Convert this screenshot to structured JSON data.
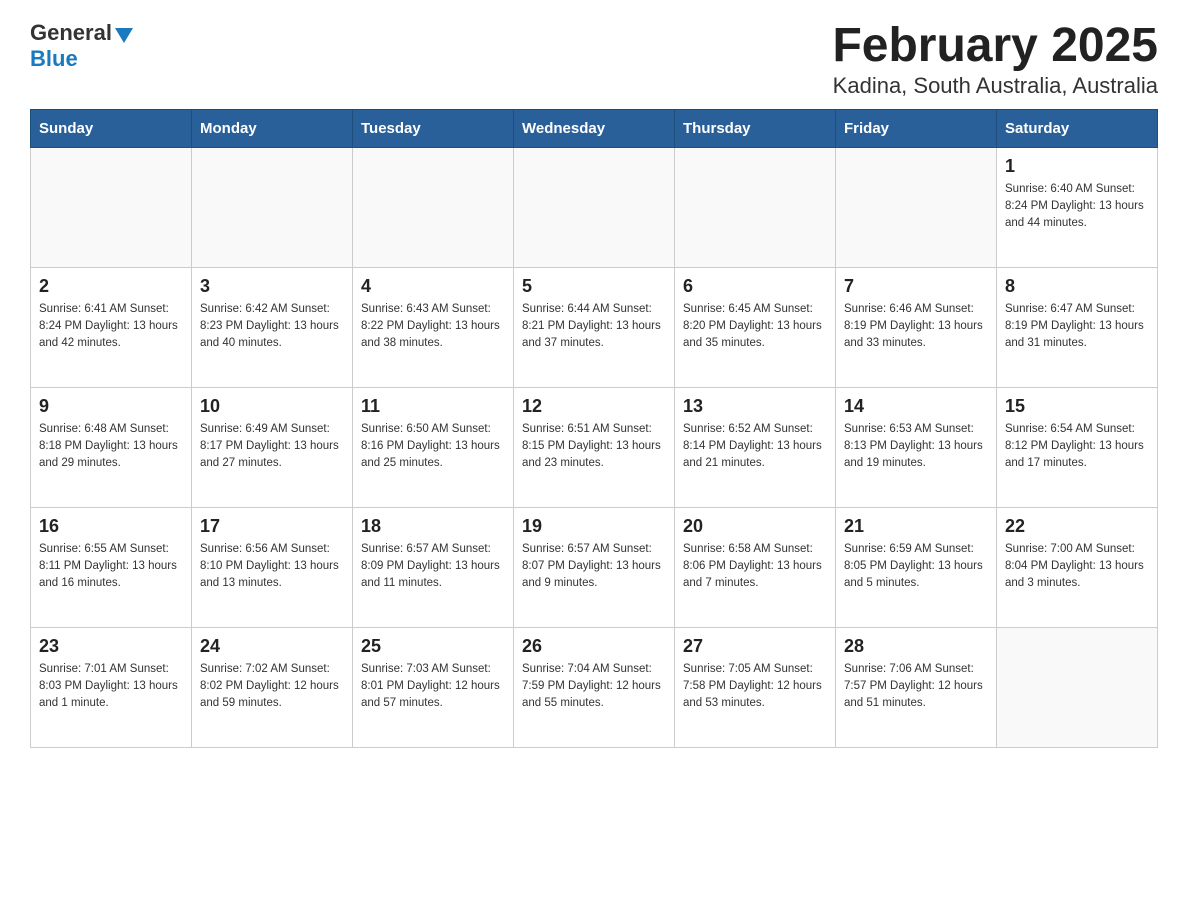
{
  "logo": {
    "general": "General",
    "blue": "Blue"
  },
  "title": "February 2025",
  "subtitle": "Kadina, South Australia, Australia",
  "weekdays": [
    "Sunday",
    "Monday",
    "Tuesday",
    "Wednesday",
    "Thursday",
    "Friday",
    "Saturday"
  ],
  "weeks": [
    [
      {
        "day": "",
        "info": ""
      },
      {
        "day": "",
        "info": ""
      },
      {
        "day": "",
        "info": ""
      },
      {
        "day": "",
        "info": ""
      },
      {
        "day": "",
        "info": ""
      },
      {
        "day": "",
        "info": ""
      },
      {
        "day": "1",
        "info": "Sunrise: 6:40 AM\nSunset: 8:24 PM\nDaylight: 13 hours\nand 44 minutes."
      }
    ],
    [
      {
        "day": "2",
        "info": "Sunrise: 6:41 AM\nSunset: 8:24 PM\nDaylight: 13 hours\nand 42 minutes."
      },
      {
        "day": "3",
        "info": "Sunrise: 6:42 AM\nSunset: 8:23 PM\nDaylight: 13 hours\nand 40 minutes."
      },
      {
        "day": "4",
        "info": "Sunrise: 6:43 AM\nSunset: 8:22 PM\nDaylight: 13 hours\nand 38 minutes."
      },
      {
        "day": "5",
        "info": "Sunrise: 6:44 AM\nSunset: 8:21 PM\nDaylight: 13 hours\nand 37 minutes."
      },
      {
        "day": "6",
        "info": "Sunrise: 6:45 AM\nSunset: 8:20 PM\nDaylight: 13 hours\nand 35 minutes."
      },
      {
        "day": "7",
        "info": "Sunrise: 6:46 AM\nSunset: 8:19 PM\nDaylight: 13 hours\nand 33 minutes."
      },
      {
        "day": "8",
        "info": "Sunrise: 6:47 AM\nSunset: 8:19 PM\nDaylight: 13 hours\nand 31 minutes."
      }
    ],
    [
      {
        "day": "9",
        "info": "Sunrise: 6:48 AM\nSunset: 8:18 PM\nDaylight: 13 hours\nand 29 minutes."
      },
      {
        "day": "10",
        "info": "Sunrise: 6:49 AM\nSunset: 8:17 PM\nDaylight: 13 hours\nand 27 minutes."
      },
      {
        "day": "11",
        "info": "Sunrise: 6:50 AM\nSunset: 8:16 PM\nDaylight: 13 hours\nand 25 minutes."
      },
      {
        "day": "12",
        "info": "Sunrise: 6:51 AM\nSunset: 8:15 PM\nDaylight: 13 hours\nand 23 minutes."
      },
      {
        "day": "13",
        "info": "Sunrise: 6:52 AM\nSunset: 8:14 PM\nDaylight: 13 hours\nand 21 minutes."
      },
      {
        "day": "14",
        "info": "Sunrise: 6:53 AM\nSunset: 8:13 PM\nDaylight: 13 hours\nand 19 minutes."
      },
      {
        "day": "15",
        "info": "Sunrise: 6:54 AM\nSunset: 8:12 PM\nDaylight: 13 hours\nand 17 minutes."
      }
    ],
    [
      {
        "day": "16",
        "info": "Sunrise: 6:55 AM\nSunset: 8:11 PM\nDaylight: 13 hours\nand 16 minutes."
      },
      {
        "day": "17",
        "info": "Sunrise: 6:56 AM\nSunset: 8:10 PM\nDaylight: 13 hours\nand 13 minutes."
      },
      {
        "day": "18",
        "info": "Sunrise: 6:57 AM\nSunset: 8:09 PM\nDaylight: 13 hours\nand 11 minutes."
      },
      {
        "day": "19",
        "info": "Sunrise: 6:57 AM\nSunset: 8:07 PM\nDaylight: 13 hours\nand 9 minutes."
      },
      {
        "day": "20",
        "info": "Sunrise: 6:58 AM\nSunset: 8:06 PM\nDaylight: 13 hours\nand 7 minutes."
      },
      {
        "day": "21",
        "info": "Sunrise: 6:59 AM\nSunset: 8:05 PM\nDaylight: 13 hours\nand 5 minutes."
      },
      {
        "day": "22",
        "info": "Sunrise: 7:00 AM\nSunset: 8:04 PM\nDaylight: 13 hours\nand 3 minutes."
      }
    ],
    [
      {
        "day": "23",
        "info": "Sunrise: 7:01 AM\nSunset: 8:03 PM\nDaylight: 13 hours\nand 1 minute."
      },
      {
        "day": "24",
        "info": "Sunrise: 7:02 AM\nSunset: 8:02 PM\nDaylight: 12 hours\nand 59 minutes."
      },
      {
        "day": "25",
        "info": "Sunrise: 7:03 AM\nSunset: 8:01 PM\nDaylight: 12 hours\nand 57 minutes."
      },
      {
        "day": "26",
        "info": "Sunrise: 7:04 AM\nSunset: 7:59 PM\nDaylight: 12 hours\nand 55 minutes."
      },
      {
        "day": "27",
        "info": "Sunrise: 7:05 AM\nSunset: 7:58 PM\nDaylight: 12 hours\nand 53 minutes."
      },
      {
        "day": "28",
        "info": "Sunrise: 7:06 AM\nSunset: 7:57 PM\nDaylight: 12 hours\nand 51 minutes."
      },
      {
        "day": "",
        "info": ""
      }
    ]
  ]
}
